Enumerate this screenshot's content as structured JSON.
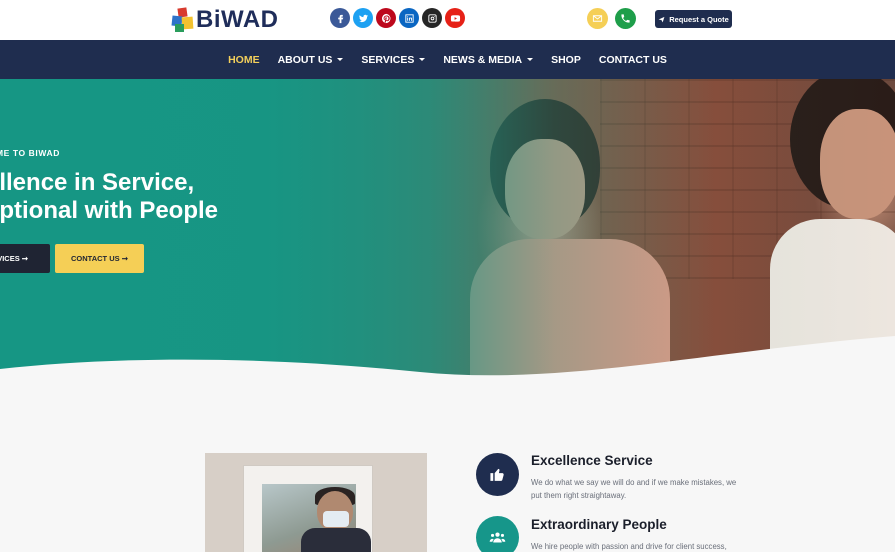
{
  "brand": {
    "name": "BiWAD"
  },
  "socials": [
    {
      "name": "facebook-icon",
      "color": "#3b5998",
      "glyph": "f"
    },
    {
      "name": "twitter-icon",
      "color": "#1da1f2",
      "glyph": "t"
    },
    {
      "name": "pinterest-icon",
      "color": "#bd081c",
      "glyph": "p"
    },
    {
      "name": "linkedin-icon",
      "color": "#0a66c2",
      "glyph": "in"
    },
    {
      "name": "instagram-icon",
      "color": "#262626",
      "glyph": "ig"
    },
    {
      "name": "youtube-icon",
      "color": "#e62117",
      "glyph": "yt"
    }
  ],
  "contact": {
    "email_icon_color": "#f5cf56",
    "phone_icon_color": "#1e9e4a",
    "quote_label": "Request a Quote"
  },
  "nav": {
    "items": [
      {
        "label": "HOME",
        "active": true,
        "dropdown": false
      },
      {
        "label": "ABOUT US",
        "active": false,
        "dropdown": true
      },
      {
        "label": "SERVICES",
        "active": false,
        "dropdown": true
      },
      {
        "label": "NEWS & MEDIA",
        "active": false,
        "dropdown": true
      },
      {
        "label": "SHOP",
        "active": false,
        "dropdown": false
      },
      {
        "label": "CONTACT US",
        "active": false,
        "dropdown": false
      }
    ]
  },
  "hero": {
    "eyebrow": "COME TO BIWAD",
    "title_line1": "ellence in Service,",
    "title_line2": "eptional with People",
    "primary_button": "RVICES ➞",
    "secondary_button": "CONTACT US ➞",
    "overlay_color": "#16968a"
  },
  "features": [
    {
      "icon": "thumbs-up-icon",
      "color": "#1f2d4f",
      "title": "Excellence Service",
      "text": "We do what we say we will do and if we make mistakes, we put them right straightaway."
    },
    {
      "icon": "users-icon",
      "color": "#16968a",
      "title": "Extraordinary People",
      "text": "We hire people with passion and drive for client success,"
    }
  ]
}
